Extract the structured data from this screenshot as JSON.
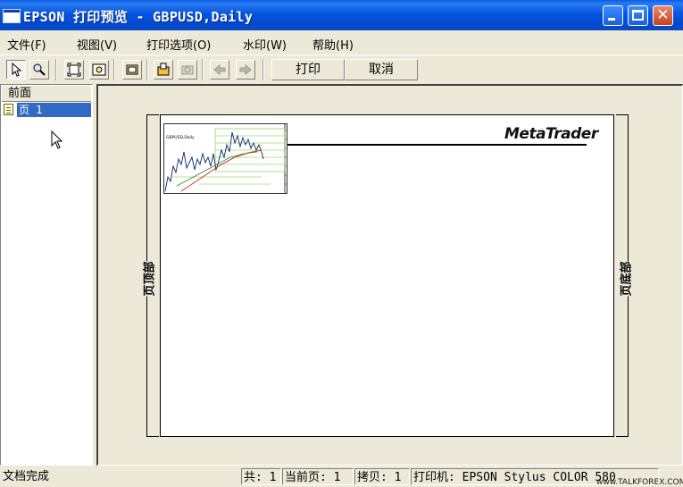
{
  "window": {
    "title": "EPSON 打印预览 - GBPUSD,Daily",
    "controls": [
      "minimize-icon",
      "maximize-icon",
      "close-icon"
    ]
  },
  "menu": [
    {
      "label": "文件(F)"
    },
    {
      "label": "视图(V)"
    },
    {
      "label": "打印选项(O)"
    },
    {
      "label": "水印(W)"
    },
    {
      "label": "帮助(H)"
    }
  ],
  "toolbar": {
    "icons": [
      "pointer-icon",
      "zoom-icon",
      "fit-page-icon",
      "zoom-region-icon",
      "page-frame-icon",
      "page-setup-icon",
      "disabled-tool-icon",
      "back-arrow-icon",
      "forward-arrow-icon"
    ],
    "print_label": "打印",
    "cancel_label": "取消"
  },
  "leftpane": {
    "header": "前面",
    "items": [
      {
        "label": "页 1",
        "selected": true
      }
    ]
  },
  "preview": {
    "header_label": "页顶部",
    "footer_label": "页底部",
    "logo": "MetaTrader",
    "thumbnail_caption": "GBPUSD,Daily"
  },
  "status": {
    "text": "文档完成",
    "total": "共: 1",
    "current_page": "当前页: 1",
    "copies": "拷贝: 1",
    "printer": "打印机: EPSON Stylus COLOR 580"
  },
  "watermark": "www.TALKFOREX.COM"
}
